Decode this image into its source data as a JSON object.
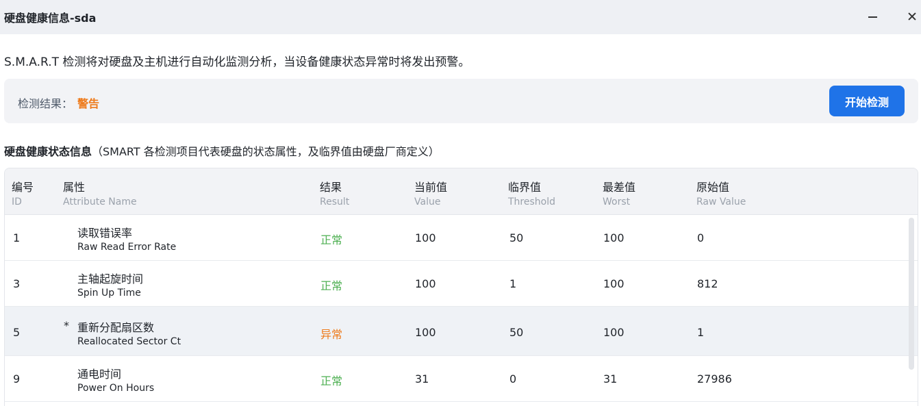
{
  "window": {
    "title": "硬盘健康信息-sda",
    "minimize_icon": "minimize-icon",
    "close_icon": "close-icon"
  },
  "description": "S.M.A.R.T 检测将对硬盘及主机进行自动化监测分析，当设备健康状态异常时将发出预警。",
  "result": {
    "label": "检测结果：",
    "value": "警告",
    "value_color": "#ee7a1a",
    "start_button": "开始检测",
    "button_color": "#1f73e8"
  },
  "section": {
    "title": "硬盘健康状态信息",
    "note": "（SMART 各检测项目代表硬盘的状态属性，及临界值由硬盘厂商定义）"
  },
  "table": {
    "columns": [
      {
        "zh": "编号",
        "en": "ID"
      },
      {
        "zh": "属性",
        "en": "Attribute Name"
      },
      {
        "zh": "结果",
        "en": "Result"
      },
      {
        "zh": "当前值",
        "en": "Value"
      },
      {
        "zh": "临界值",
        "en": "Threshold"
      },
      {
        "zh": "最差值",
        "en": "Worst"
      },
      {
        "zh": "原始值",
        "en": "Raw Value"
      }
    ],
    "rows": [
      {
        "id": "1",
        "flag": "",
        "name_zh": "读取错误率",
        "name_en": "Raw Read Error Rate",
        "result": "正常",
        "status": "ok",
        "value": "100",
        "threshold": "50",
        "worst": "100",
        "raw": "0"
      },
      {
        "id": "3",
        "flag": "",
        "name_zh": "主轴起旋时间",
        "name_en": "Spin Up Time",
        "result": "正常",
        "status": "ok",
        "value": "100",
        "threshold": "1",
        "worst": "100",
        "raw": "812"
      },
      {
        "id": "5",
        "flag": "*",
        "name_zh": "重新分配扇区数",
        "name_en": "Reallocated Sector Ct",
        "result": "异常",
        "status": "bad",
        "value": "100",
        "threshold": "50",
        "worst": "100",
        "raw": "1"
      },
      {
        "id": "9",
        "flag": "",
        "name_zh": "通电时间",
        "name_en": "Power On Hours",
        "result": "正常",
        "status": "ok",
        "value": "31",
        "threshold": "0",
        "worst": "31",
        "raw": "27986"
      }
    ]
  }
}
